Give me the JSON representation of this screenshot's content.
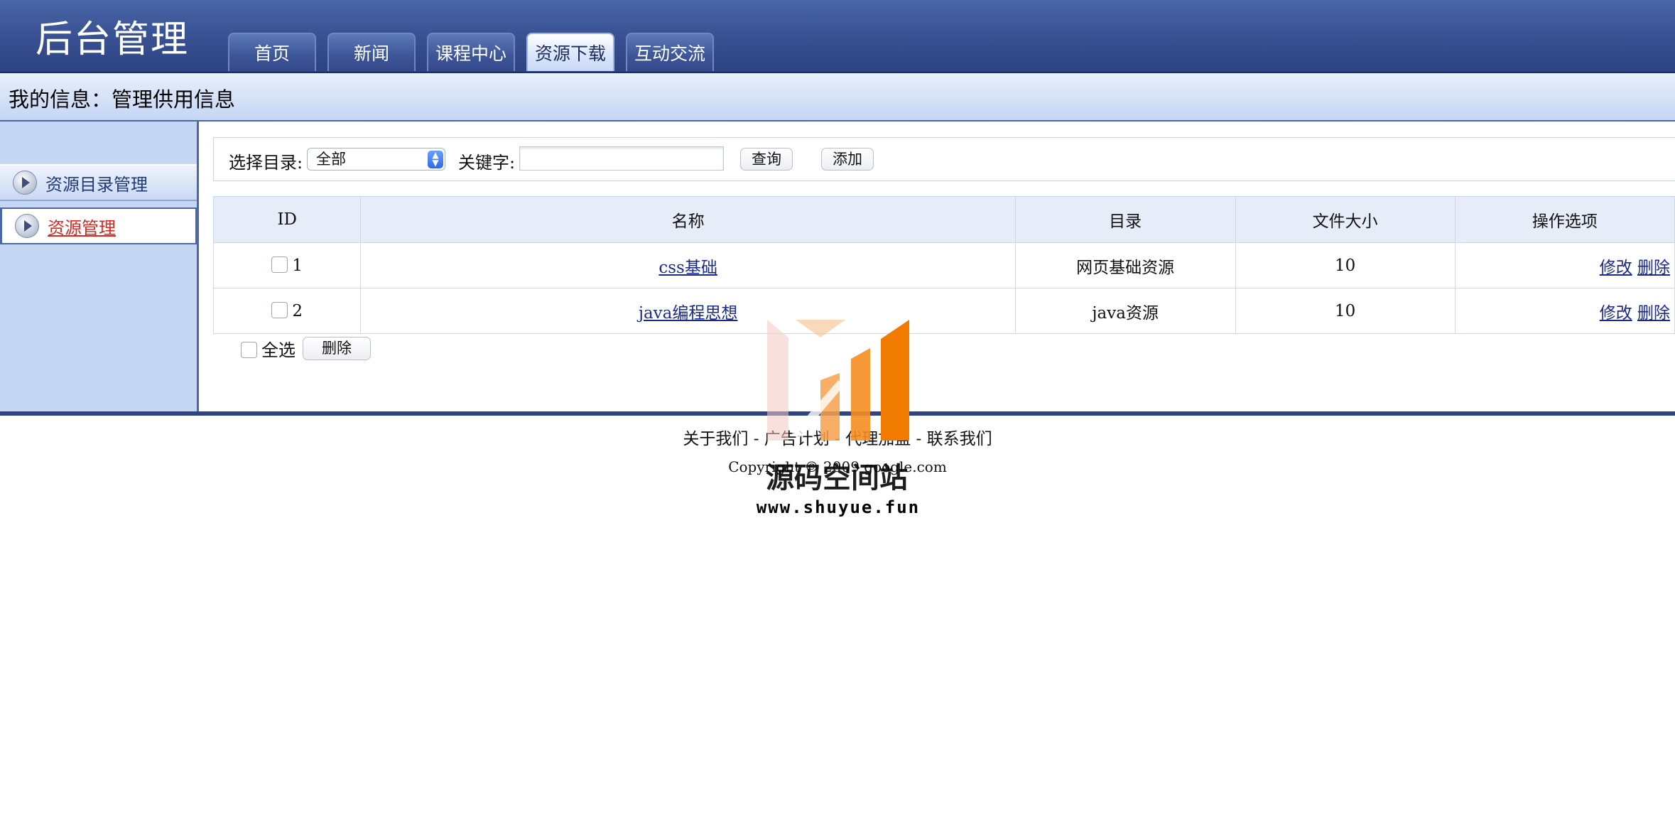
{
  "header": {
    "title": "后台管理",
    "tabs": [
      {
        "label": "首页"
      },
      {
        "label": "新闻"
      },
      {
        "label": "课程中心"
      },
      {
        "label": "资源下载",
        "active": true
      },
      {
        "label": "互动交流"
      }
    ]
  },
  "infobar": {
    "text": "我的信息：管理供用信息"
  },
  "sidebar": {
    "items": [
      {
        "label": "资源目录管理"
      },
      {
        "label": "资源管理",
        "active": true
      }
    ]
  },
  "toolbar": {
    "dir_label": "选择目录:",
    "dir_value": "全部",
    "keyword_label": "关键字:",
    "keyword_value": "",
    "query_label": "查询",
    "add_label": "添加"
  },
  "table": {
    "headers": [
      "ID",
      "名称",
      "目录",
      "文件大小",
      "操作选项"
    ],
    "rows": [
      {
        "id": "1",
        "name": "css基础",
        "dir": "网页基础资源",
        "size": "10",
        "edit": "修改",
        "delete": "删除"
      },
      {
        "id": "2",
        "name": "java编程思想",
        "dir": "java资源",
        "size": "10",
        "edit": "修改",
        "delete": "删除"
      }
    ]
  },
  "bulk": {
    "select_all_label": "全选",
    "delete_label": "删除"
  },
  "footer": {
    "links": [
      "关于我们",
      "广告计划",
      "代理加盟",
      "联系我们"
    ],
    "separator": "-",
    "copyright": "Copyright © 2009 google.com"
  },
  "watermark": {
    "text": "源码空间站",
    "url": "www.shuyue.fun"
  },
  "colors": {
    "header": "#3a5394",
    "sidebar": "#c6d7f4",
    "active_side": "#d42a1f",
    "link": "#1a2a8a"
  }
}
